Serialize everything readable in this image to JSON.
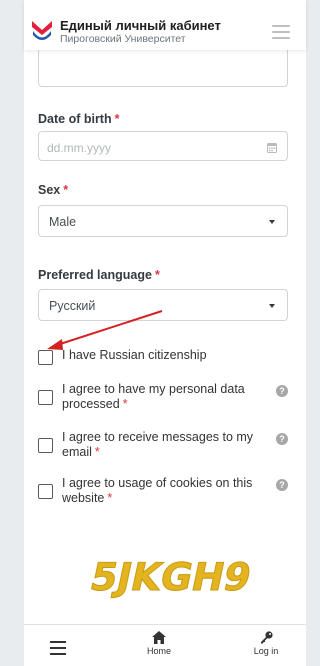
{
  "header": {
    "title": "Единый личный кабинет",
    "subtitle": "Пироговский Университет"
  },
  "form": {
    "dob": {
      "label": "Date of birth",
      "required": "*",
      "placeholder": "dd.mm.yyyy"
    },
    "sex": {
      "label": "Sex",
      "required": "*",
      "value": "Male"
    },
    "language": {
      "label": "Preferred language",
      "required": "*",
      "value": "Русский"
    },
    "checkboxes": [
      {
        "text": "I have Russian citizenship",
        "required": ""
      },
      {
        "text": "I agree to have my personal data processed",
        "required": "*"
      },
      {
        "text": "I agree to receive messages to my email",
        "required": "*"
      },
      {
        "text": "I agree to usage of cookies on this website",
        "required": "*"
      }
    ],
    "captcha_text": "5JKGH9"
  },
  "bottom_nav": {
    "items": [
      {
        "label": "",
        "icon": "menu-icon"
      },
      {
        "label": "Home",
        "icon": "home-icon"
      },
      {
        "label": "Log in",
        "icon": "key-icon"
      }
    ]
  },
  "colors": {
    "brand_red": "#e2203b",
    "brand_blue": "#1f5aa6",
    "required": "#dc3545",
    "captcha": "#e3b41f",
    "arrow": "#d42222"
  }
}
